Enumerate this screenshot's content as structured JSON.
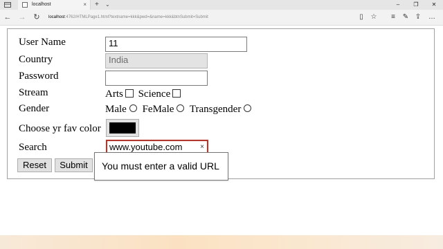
{
  "browser": {
    "tab_title": "localhost",
    "tab_close": "×",
    "new_tab": "+",
    "tab_menu": "⌄",
    "window_buttons": {
      "minimize": "–",
      "restore": "❐",
      "close": "✕"
    },
    "nav": {
      "back": "←",
      "forward": "→",
      "refresh": "↻"
    },
    "url_host": "localhost",
    "url_rest": ":4762/HTMLPage1.html?textname=kkk&pwd=&name=kkk&btnSubmit=Submit",
    "toolbar": {
      "reading_view": "▯",
      "favorite": "☆",
      "hub": "≡",
      "notes": "✎",
      "share": "⇪",
      "more": "…"
    }
  },
  "form": {
    "username_label": "User Name",
    "username_value": "11",
    "country_label": "Country",
    "country_value": "India",
    "password_label": "Password",
    "password_value": "",
    "stream_label": "Stream",
    "stream_options": [
      "Arts",
      "Science"
    ],
    "gender_label": "Gender",
    "gender_options": [
      "Male",
      "FeMale",
      "Transgender"
    ],
    "color_label": "Choose yr fav color",
    "color_value": "#000000",
    "search_label": "Search",
    "search_value": "www.youtube.com",
    "search_clear": "×",
    "reset_label": "Reset",
    "submit_label": "Submit"
  },
  "validation_tooltip": "You must enter a valid URL"
}
